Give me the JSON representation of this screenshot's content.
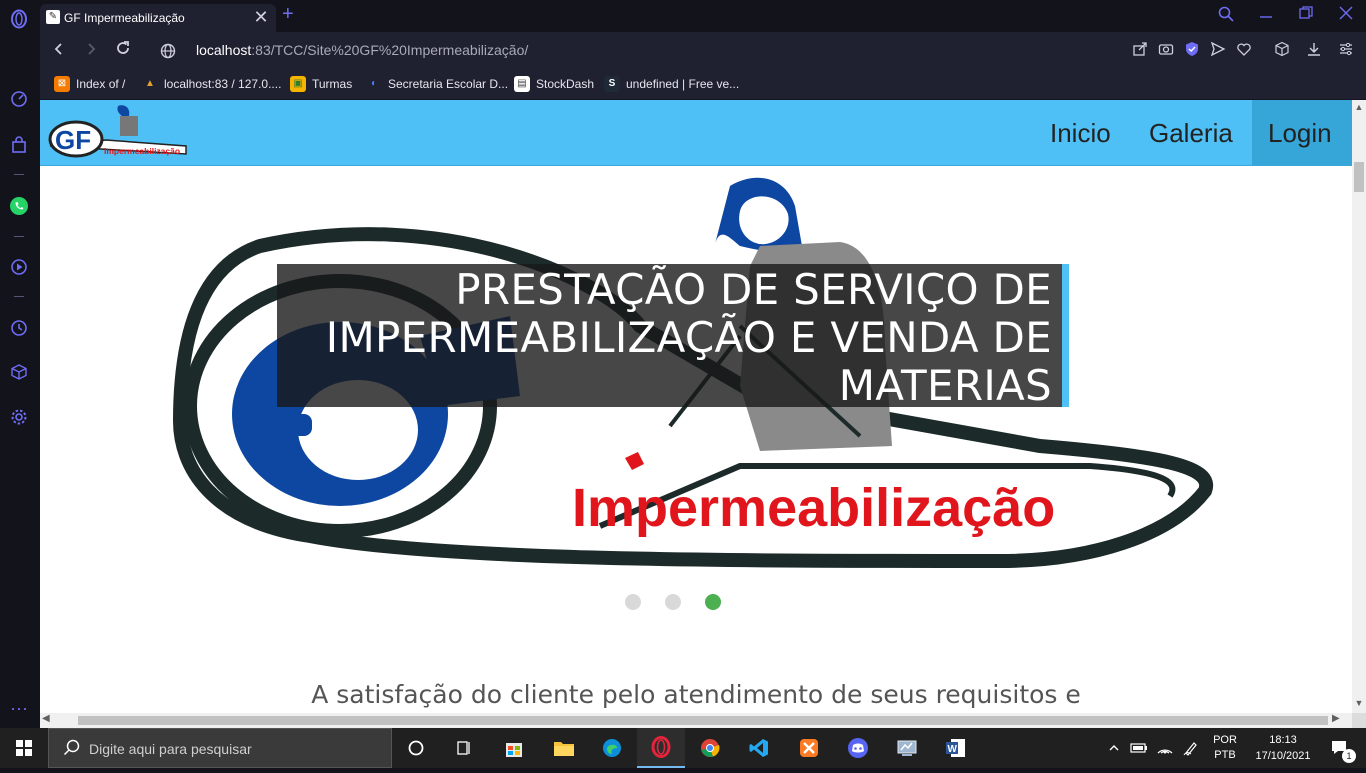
{
  "browser": {
    "tab_title": "GF Impermeabilização",
    "tab_close": "✕",
    "new_tab": "+",
    "url_host": "localhost",
    "url_rest": ":83/TCC/Site%20GF%20Impermeabilização/"
  },
  "bookmarks": [
    {
      "label": "Index of /",
      "color": "#f57c00",
      "glyph": "⊠"
    },
    {
      "label": "localhost:83 / 127.0....",
      "color": "#e0a030",
      "glyph": "▲"
    },
    {
      "label": "Turmas",
      "color": "#f4b400",
      "glyph": "▣"
    },
    {
      "label": "Secretaria Escolar D...",
      "color": "#3b82f6",
      "glyph": "◐"
    },
    {
      "label": "StockDash",
      "color": "#ffffff",
      "glyph": "▤"
    },
    {
      "label": "undefined | Free ve...",
      "color": "#1f2937",
      "glyph": "S"
    }
  ],
  "site": {
    "logo_text": "Impermeabilização",
    "logo_initials": "GF",
    "menu": [
      "Inicio",
      "Galeria",
      "Login"
    ],
    "hero_caption": [
      "PRESTAÇÃO DE SERVIÇO DE",
      "IMPERMEABILIZAÇÃO E VENDA DE",
      "MATERIAS"
    ],
    "hero_brand": "Impermeabilização",
    "carousel": {
      "slides": 3,
      "active": 3
    },
    "tagline": "A satisfação do cliente pelo atendimento de seus requisitos e"
  },
  "taskbar": {
    "search_placeholder": "Digite aqui para pesquisar",
    "lang_top": "POR",
    "lang_bottom": "PTB",
    "time": "18:13",
    "date": "17/10/2021",
    "notif_count": "1"
  },
  "colors": {
    "header": "#4fc0f5",
    "accent_dot": "#4caf50",
    "brand_red": "#e0161c",
    "brand_blue": "#0d47a1"
  }
}
